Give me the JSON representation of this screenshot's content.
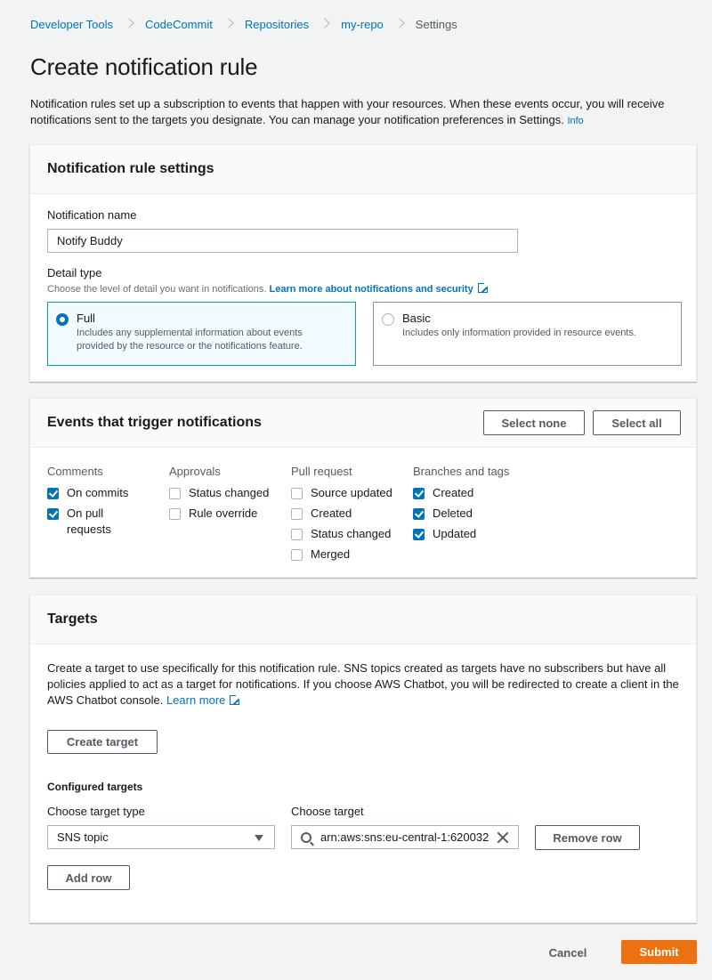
{
  "breadcrumb": [
    {
      "label": "Developer Tools"
    },
    {
      "label": "CodeCommit"
    },
    {
      "label": "Repositories"
    },
    {
      "label": "my-repo"
    },
    {
      "label": "Settings"
    }
  ],
  "page_title": "Create notification rule",
  "intro": {
    "text": "Notification rules set up a subscription to events that happen with your resources. When these events occur, you will receive notifications sent to the targets you designate. You can manage your notification preferences in Settings.",
    "info_link": "Info"
  },
  "settings_panel": {
    "title": "Notification rule settings",
    "name_label": "Notification name",
    "name_value": "Notify Buddy",
    "detail_type_label": "Detail type",
    "detail_type_desc": "Choose the level of detail you want in notifications.",
    "detail_type_link": "Learn more about notifications and security",
    "options": [
      {
        "title": "Full",
        "desc": "Includes any supplemental information about events provided by the resource or the notifications feature.",
        "selected": true
      },
      {
        "title": "Basic",
        "desc": "Includes only information provided in resource events.",
        "selected": false
      }
    ]
  },
  "events_panel": {
    "title": "Events that trigger notifications",
    "select_none": "Select none",
    "select_all": "Select all",
    "groups": [
      {
        "title": "Comments",
        "items": [
          {
            "label": "On commits",
            "checked": true
          },
          {
            "label": "On pull requests",
            "checked": true
          }
        ]
      },
      {
        "title": "Approvals",
        "items": [
          {
            "label": "Status changed",
            "checked": false
          },
          {
            "label": "Rule override",
            "checked": false
          }
        ]
      },
      {
        "title": "Pull request",
        "items": [
          {
            "label": "Source updated",
            "checked": false
          },
          {
            "label": "Created",
            "checked": false
          },
          {
            "label": "Status changed",
            "checked": false
          },
          {
            "label": "Merged",
            "checked": false
          }
        ]
      },
      {
        "title": "Branches and tags",
        "items": [
          {
            "label": "Created",
            "checked": true
          },
          {
            "label": "Deleted",
            "checked": true
          },
          {
            "label": "Updated",
            "checked": true
          }
        ]
      }
    ]
  },
  "targets_panel": {
    "title": "Targets",
    "desc": "Create a target to use specifically for this notification rule. SNS topics created as targets have no subscribers but have all policies applied to act as a target for notifications. If you choose AWS Chatbot, you will be redirected to create a client in the AWS Chatbot console.",
    "learn_more": "Learn more",
    "create_target": "Create target",
    "configured_label": "Configured targets",
    "target_type_label": "Choose target type",
    "target_type_value": "SNS topic",
    "target_label": "Choose target",
    "target_value": "arn:aws:sns:eu-central-1:620032",
    "remove_row": "Remove row",
    "add_row": "Add row"
  },
  "footer": {
    "cancel": "Cancel",
    "submit": "Submit"
  }
}
